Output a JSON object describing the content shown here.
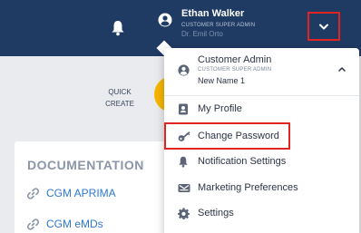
{
  "header": {
    "user_name": "Ethan Walker",
    "user_role": "CUSTOMER SUPER ADMIN",
    "user_subtitle": "Dr. Emil Orto",
    "icons": [
      "bell-icon",
      "user-circle-icon",
      "chevron-down-icon"
    ]
  },
  "quick_create": {
    "line1": "QUICK",
    "line2": "CREATE"
  },
  "documentation": {
    "title": "DOCUMENTATION",
    "links": [
      "CGM APRIMA",
      "CGM eMDs"
    ]
  },
  "dropdown": {
    "account_name": "Customer Admin",
    "account_role": "CUSTOMER SUPER ADMIN",
    "account_subtitle": "New Name 1",
    "items": [
      {
        "label": "My Profile",
        "icon": "contact-card-icon"
      },
      {
        "label": "Change Password",
        "icon": "key-icon"
      },
      {
        "label": "Notification Settings",
        "icon": "bell-icon"
      },
      {
        "label": "Marketing Preferences",
        "icon": "megaphone-icon"
      },
      {
        "label": "Settings",
        "icon": "gear-icon"
      }
    ]
  },
  "colors": {
    "header_bg": "#1f3a63",
    "accent_yellow": "#f7b500",
    "link_blue": "#2f77d1",
    "highlight_red": "#e02424"
  }
}
